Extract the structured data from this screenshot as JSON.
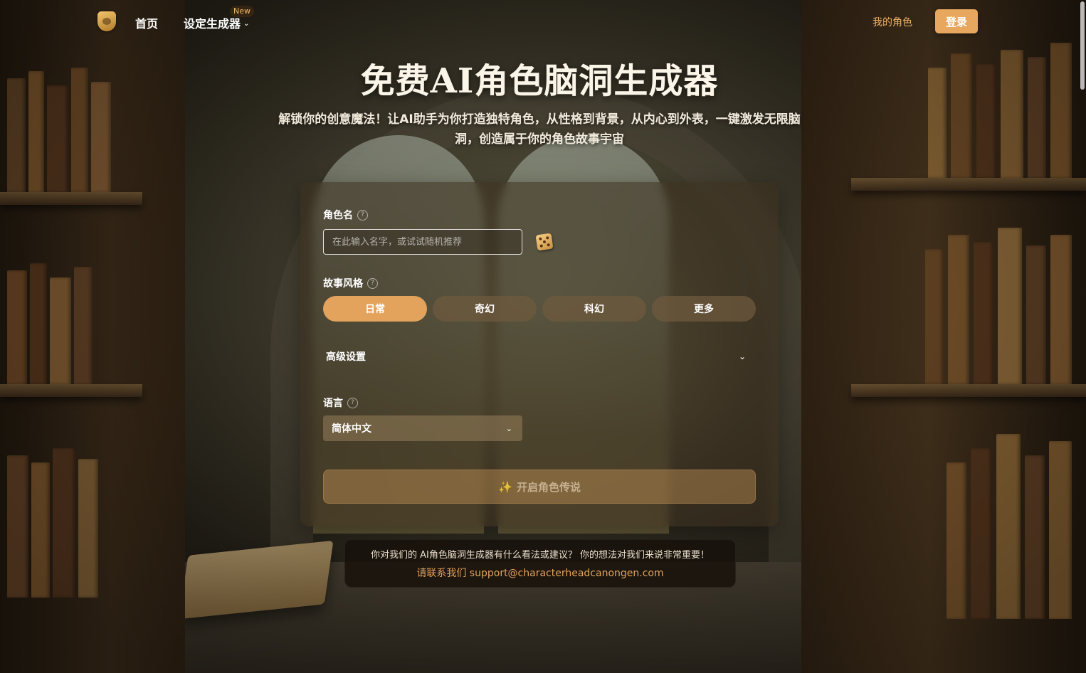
{
  "header": {
    "nav_home": "首页",
    "nav_generator": "设定生成器",
    "nav_generator_badge": "New",
    "my_roles": "我的角色",
    "login": "登录",
    "logo_icon": "shield-logo-icon"
  },
  "hero": {
    "title": "免费AI角色脑洞生成器",
    "subtitle": "解锁你的创意魔法！让AI助手为你打造独特角色，从性格到背景，从内心到外表，一键激发无限脑洞，创造属于你的角色故事宇宙"
  },
  "form": {
    "name_label": "角色名",
    "name_placeholder": "在此输入名字，或试试随机推荐",
    "name_value": "",
    "random_icon": "dice-icon",
    "style_label": "故事风格",
    "styles": [
      {
        "label": "日常",
        "active": true
      },
      {
        "label": "奇幻",
        "active": false
      },
      {
        "label": "科幻",
        "active": false
      },
      {
        "label": "更多",
        "active": false
      }
    ],
    "advanced_label": "高级设置",
    "language_label": "语言",
    "language_value": "简体中文",
    "submit_label": "开启角色传说"
  },
  "feedback": {
    "line1": "你对我们的 AI角色脑洞生成器有什么看法或建议？ 你的想法对我们来说非常重要！",
    "line2": "请联系我们 support@characterheadcanongen.com"
  },
  "colors": {
    "accent": "#e3a35c",
    "login_bg": "#e7a75e",
    "link": "#e9b166"
  }
}
